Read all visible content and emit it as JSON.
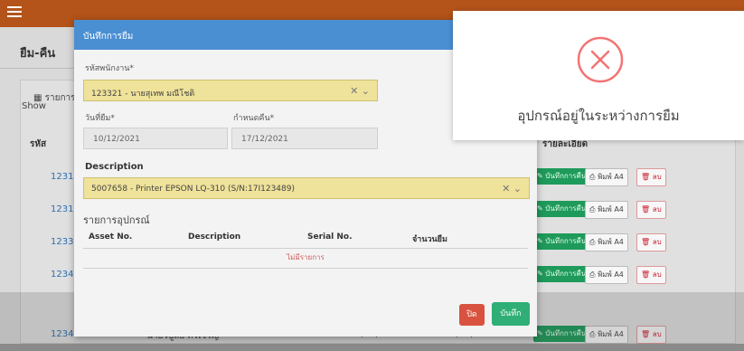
{
  "app": {
    "page_title": "ยืม-คืน",
    "panel_tab": "รายการ",
    "show_label": "Show",
    "col_code": "รหัส",
    "col_detail": "รายละเอียด",
    "rows": [
      {
        "code": "12312",
        "name": "",
        "d1": "",
        "d2": ""
      },
      {
        "code": "12312",
        "name": "",
        "d1": "",
        "d2": ""
      },
      {
        "code": "12332",
        "name": "",
        "d1": "",
        "d2": ""
      },
      {
        "code": "12345",
        "name": "",
        "d1": "",
        "d2": ""
      },
      {
        "code": "123456",
        "name": "นายวิบูลย์ ศรีเจริญ",
        "d1": "24/11/2021",
        "d2": "25/11/2021"
      }
    ],
    "btn_return": "บันทึกการคืน",
    "btn_print": "พิมพ์ A4",
    "btn_delete": "ลบ"
  },
  "modal": {
    "title": "บันทึกการยืม",
    "employee_label": "รหัสพนักงาน*",
    "employee_value": "123321 - นายสุเทพ มณีโชติ",
    "borrow_date_label": "วันที่ยืม*",
    "borrow_date_value": "10/12/2021",
    "due_date_label": "กำหนดคืน*",
    "due_date_value": "17/12/2021",
    "description_label": "Description",
    "description_value": "5007658 - Printer EPSON LQ-310 (S/N:17I123489)",
    "section_title": "รายการอุปกรณ์",
    "table_headers": [
      "Asset No.",
      "Description",
      "Serial No.",
      "จำนวนยืม"
    ],
    "empty_text": "ไม่มีรายการ",
    "close_button": "ปิด",
    "save_button": "บันทึก"
  },
  "toast": {
    "message": "อุปกรณ์อยู่ในระหว่างการยืม",
    "icon": "error-circle-x-icon",
    "icon_color": "#f27474"
  },
  "colors": {
    "topbar": "#b4531a",
    "modal_header": "#4b8fd3",
    "select_bg": "#efe29a",
    "save": "#2fae75",
    "close": "#d8523f"
  }
}
